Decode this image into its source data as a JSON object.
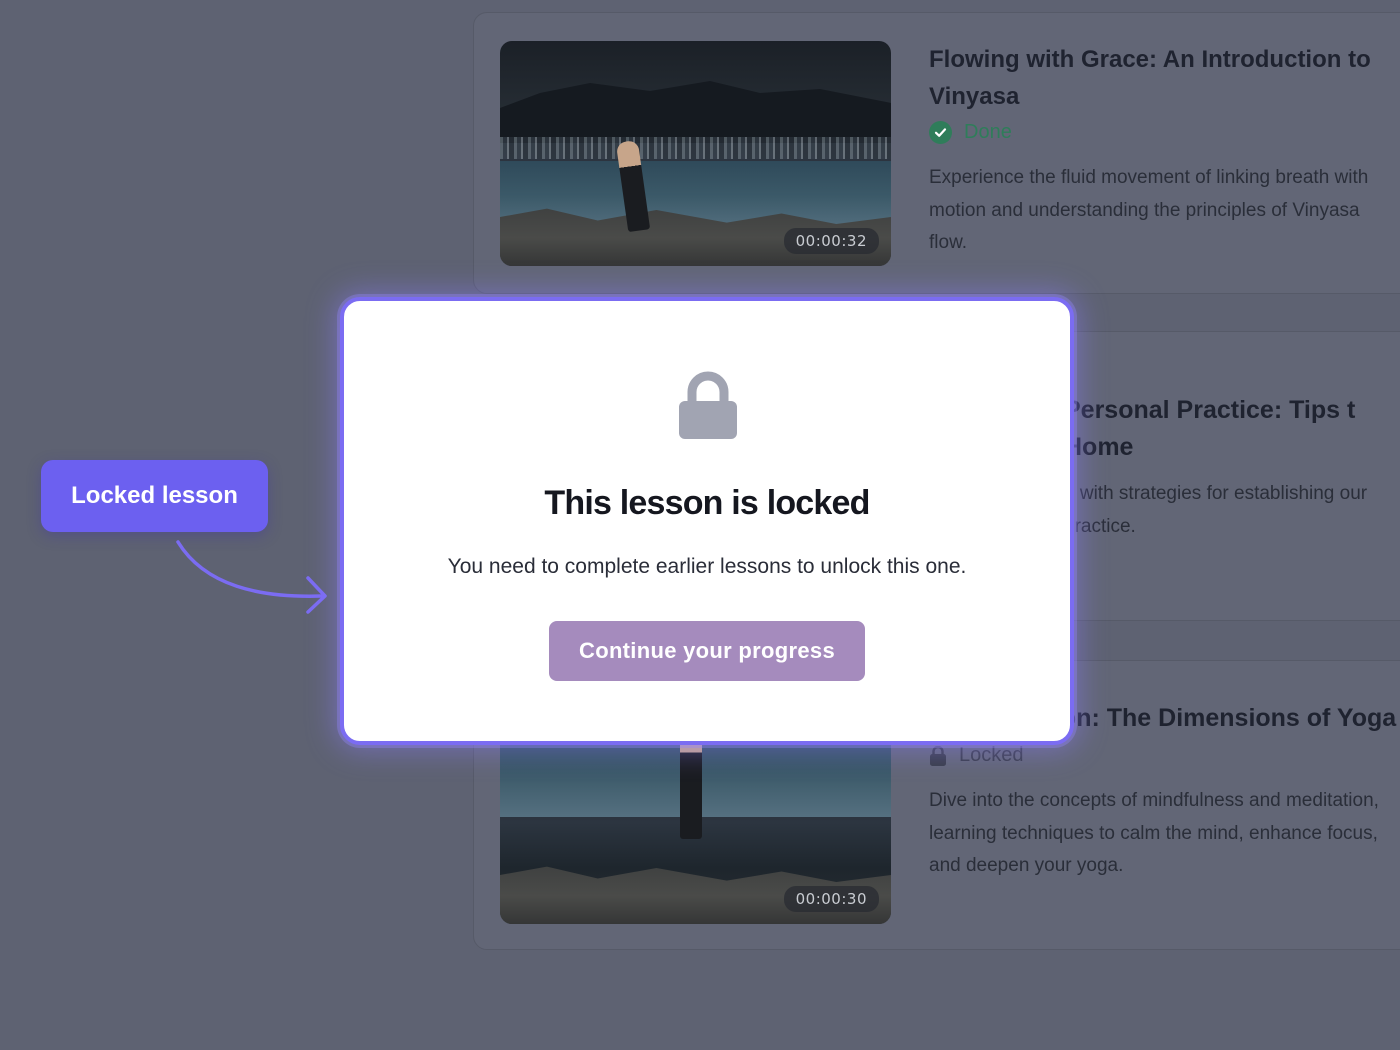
{
  "lessons": [
    {
      "title": "Flowing with Grace: An Introduction to Vinyasa",
      "status": "Done",
      "status_icon": "check-circle-icon",
      "description": "Experience the fluid movement of linking breath with motion and understanding the principles of Vinyasa flow.",
      "duration": "00:00:32"
    },
    {
      "title": "Personal Practice: Tips t Home",
      "description": "g with strategies for establishing our practice."
    },
    {
      "title": "nd Meditation: The Dimensions of Yoga",
      "status": "Locked",
      "status_icon": "lock-icon",
      "description": "Dive into the concepts of mindfulness and meditation, learning techniques to calm the mind, enhance focus, and deepen your yoga.",
      "duration": "00:00:30"
    }
  ],
  "callout": {
    "label": "Locked lesson",
    "color": "#6c60f0"
  },
  "modal": {
    "icon": "lock-icon",
    "title": "This lesson is locked",
    "message": "You need to complete earlier lessons to unlock this one.",
    "button_label": "Continue your progress",
    "accent_color": "#7b6cf2",
    "button_color": "#a58bbd"
  },
  "colors": {
    "overlay_background": "#5e6272",
    "done_green": "#2f7d5a"
  }
}
